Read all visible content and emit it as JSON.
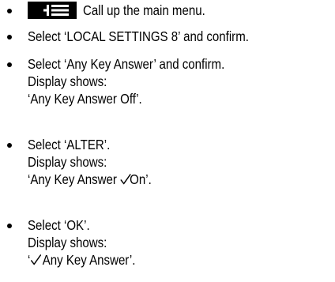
{
  "steps": [
    {
      "icon": "menu-key-icon",
      "lines": [
        "Call up the main menu."
      ]
    },
    {
      "lines": [
        "Select ‘LOCAL SETTINGS 8’ and confirm."
      ]
    },
    {
      "lines": [
        "Select ‘Any Key Answer’ and confirm.",
        "Display shows:",
        "‘Any Key Answer Off’."
      ]
    },
    {
      "lines": [
        "Select ‘ALTER’.",
        "Display shows:"
      ],
      "display_line": {
        "before": "‘Any Key Answer ",
        "check_icon": "checkmark-icon",
        "after": "On’."
      }
    },
    {
      "lines": [
        "Select ‘OK’.",
        "Display shows:"
      ],
      "display_line": {
        "before": "‘",
        "check_icon": "checkmark-icon",
        "after": " Any Key Answer’."
      }
    }
  ]
}
